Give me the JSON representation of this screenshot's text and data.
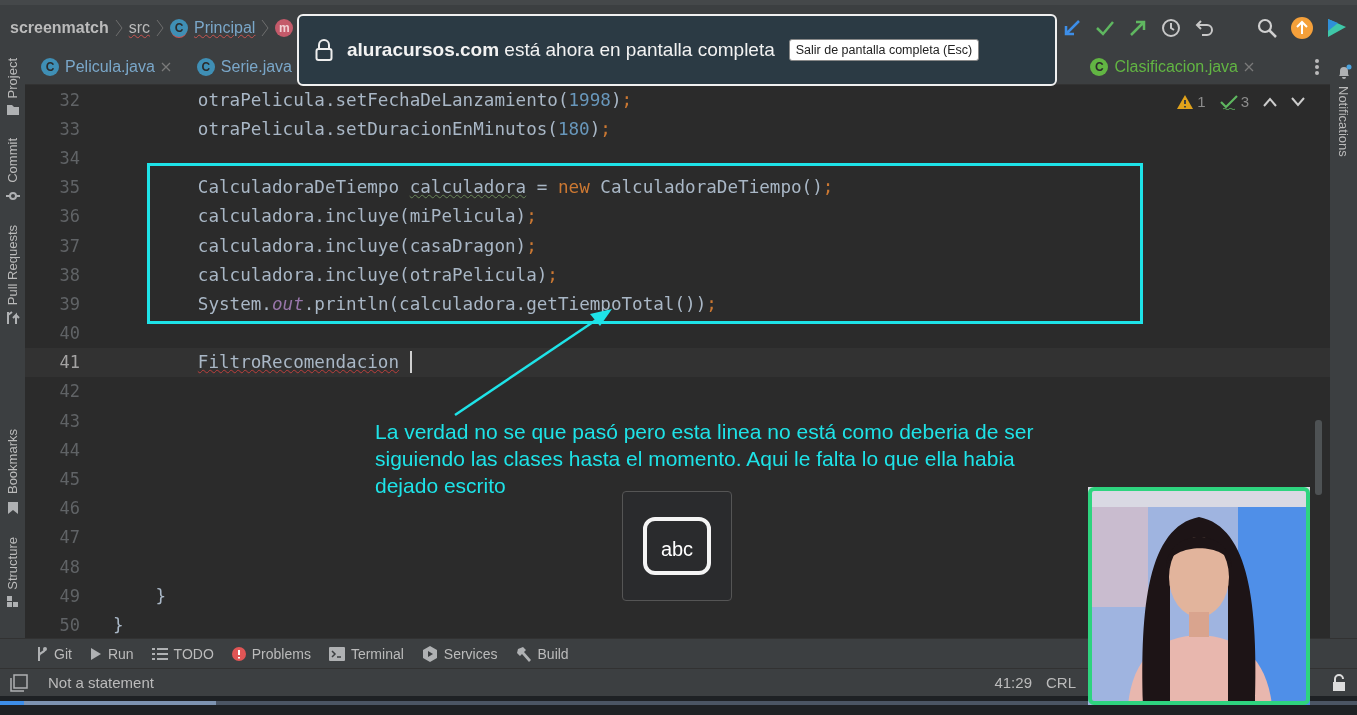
{
  "breadcrumbs": [
    {
      "label": "screenmatch",
      "kind": "project",
      "has_errors": false
    },
    {
      "label": "src",
      "kind": "folder",
      "has_errors": true
    },
    {
      "label": "Principal",
      "kind": "class",
      "badge": "C",
      "has_errors": true
    },
    {
      "kind": "method",
      "badge": "m",
      "has_errors": false
    }
  ],
  "tabs": [
    {
      "label": "Pelicula.java",
      "badge": "C",
      "vcs_added": false,
      "closable": true,
      "selected": false
    },
    {
      "label": "Serie.java",
      "badge": "C",
      "vcs_added": false,
      "closable": false,
      "selected": false
    },
    {
      "label": "Clasificacion.java",
      "badge": "C",
      "vcs_added": true,
      "closable": true,
      "selected": false
    }
  ],
  "inspections": {
    "warnings": "1",
    "weak_warnings": "3"
  },
  "left_tool_tabs": [
    {
      "label": "Project",
      "kind": "project"
    },
    {
      "label": "Commit",
      "kind": "commit"
    },
    {
      "label": "Pull Requests",
      "kind": "pull"
    },
    {
      "label": "Bookmarks",
      "kind": "bookmarks"
    },
    {
      "label": "Structure",
      "kind": "structure"
    }
  ],
  "right_tool_tabs": [
    {
      "label": "Notifications",
      "kind": "notifications"
    }
  ],
  "code": [
    {
      "number": "32",
      "kind": "statement",
      "current": false,
      "caret": false,
      "tokens": [
        {
          "text": "otraPelicula.setFechaDeLanzamiento(",
          "kind": "plain"
        },
        {
          "text": "1998",
          "kind": "number"
        },
        {
          "text": ")",
          "kind": "plain"
        },
        {
          "text": ";",
          "kind": "punct"
        }
      ]
    },
    {
      "number": "33",
      "kind": "statement",
      "current": false,
      "caret": false,
      "tokens": [
        {
          "text": "otraPelicula.setDuracionEnMinutos(",
          "kind": "plain"
        },
        {
          "text": "180",
          "kind": "number"
        },
        {
          "text": ")",
          "kind": "plain"
        },
        {
          "text": ";",
          "kind": "punct"
        }
      ]
    },
    {
      "number": "34",
      "current": false,
      "caret": false
    },
    {
      "number": "35",
      "kind": "statement",
      "current": false,
      "caret": false,
      "tokens": [
        {
          "text": "CalculadoraDeTiempo ",
          "kind": "plain"
        },
        {
          "text": "calculadora",
          "kind": "warning"
        },
        {
          "text": " = ",
          "kind": "plain"
        },
        {
          "text": "new",
          "kind": "keyword"
        },
        {
          "text": " CalculadoraDeTiempo()",
          "kind": "plain"
        },
        {
          "text": ";",
          "kind": "punct"
        }
      ]
    },
    {
      "number": "36",
      "kind": "statement",
      "current": false,
      "caret": false,
      "tokens": [
        {
          "text": "calculadora.incluye(miPelicula)",
          "kind": "plain"
        },
        {
          "text": ";",
          "kind": "punct"
        }
      ]
    },
    {
      "number": "37",
      "kind": "statement",
      "current": false,
      "caret": false,
      "tokens": [
        {
          "text": "calculadora.incluye(casaDragon)",
          "kind": "plain"
        },
        {
          "text": ";",
          "kind": "punct"
        }
      ]
    },
    {
      "number": "38",
      "kind": "statement",
      "current": false,
      "caret": false,
      "tokens": [
        {
          "text": "calculadora.incluye(otraPelicula)",
          "kind": "plain"
        },
        {
          "text": ";",
          "kind": "punct"
        }
      ]
    },
    {
      "number": "39",
      "kind": "statement",
      "current": false,
      "caret": false,
      "tokens": [
        {
          "text": "System.",
          "kind": "plain"
        },
        {
          "text": "out",
          "kind": "static"
        },
        {
          "text": ".println(calculadora.getTiempoTotal())",
          "kind": "plain"
        },
        {
          "text": ";",
          "kind": "punct"
        }
      ]
    },
    {
      "number": "40",
      "current": false,
      "caret": false
    },
    {
      "number": "41",
      "kind": "statement",
      "current": true,
      "caret": true,
      "tokens": [
        {
          "text": "FiltroRecomendacion",
          "kind": "error"
        }
      ]
    },
    {
      "number": "42",
      "current": false,
      "caret": false
    },
    {
      "number": "43",
      "current": false,
      "caret": false
    },
    {
      "number": "44",
      "current": false,
      "caret": false
    },
    {
      "number": "45",
      "current": false,
      "caret": false
    },
    {
      "number": "46",
      "current": false,
      "caret": false
    },
    {
      "number": "47",
      "current": false,
      "caret": false
    },
    {
      "number": "48",
      "current": false,
      "caret": false
    },
    {
      "number": "49",
      "kind": "brace",
      "current": false,
      "caret": false,
      "tokens": [
        {
          "text": "}",
          "kind": "plain"
        }
      ]
    },
    {
      "number": "50",
      "kind": "toplevel",
      "current": false,
      "caret": false,
      "tokens": [
        {
          "text": "}",
          "kind": "plain"
        }
      ]
    }
  ],
  "tool_windows": [
    {
      "label": "Git",
      "kind": "git"
    },
    {
      "label": "Run",
      "kind": "run"
    },
    {
      "label": "TODO",
      "kind": "todo"
    },
    {
      "label": "Problems",
      "kind": "problems"
    },
    {
      "label": "Terminal",
      "kind": "terminal"
    },
    {
      "label": "Services",
      "kind": "services"
    },
    {
      "label": "Build",
      "kind": "build"
    }
  ],
  "status_bar": {
    "message": "Not a statement",
    "position": "41:29",
    "line_separator": "CRL"
  },
  "fullscreen_notice": {
    "message": "**aluracursos.com** está ahora en pantalla completa",
    "exit_button": "Salir de pantalla completa (Esc)"
  },
  "annotation": {
    "note": "La verdad no se que pasó pero esta linea no está como deberia de ser siguiendo las clases hasta el momento. Aqui le falta lo que ella habia dejado escrito"
  },
  "input_indicator": {
    "label": "abc"
  },
  "video_progress": {
    "played": {
      "level": 0.018
    },
    "buffered": {
      "level": 0.159
    }
  }
}
